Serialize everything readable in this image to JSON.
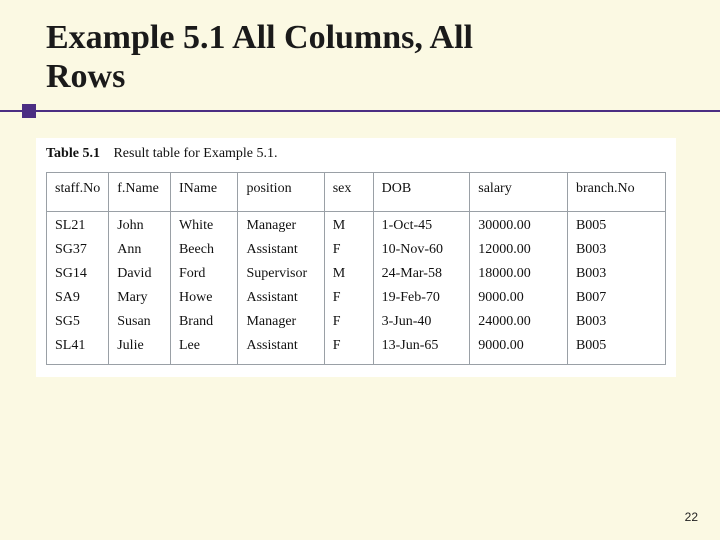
{
  "title_line1": "Example 5.1  All Columns, All",
  "title_line2": "Rows",
  "caption_number": "Table 5.1",
  "caption_text": "Result table for Example 5.1.",
  "columns": [
    "staff.No",
    "f.Name",
    "IName",
    "position",
    "sex",
    "DOB",
    "salary",
    "branch.No"
  ],
  "rows": [
    {
      "staffNo": "SL21",
      "fName": "John",
      "lName": "White",
      "position": "Manager",
      "sex": "M",
      "dob": "1-Oct-45",
      "salary": "30000.00",
      "branchNo": "B005"
    },
    {
      "staffNo": "SG37",
      "fName": "Ann",
      "lName": "Beech",
      "position": "Assistant",
      "sex": "F",
      "dob": "10-Nov-60",
      "salary": "12000.00",
      "branchNo": "B003"
    },
    {
      "staffNo": "SG14",
      "fName": "David",
      "lName": "Ford",
      "position": "Supervisor",
      "sex": "M",
      "dob": "24-Mar-58",
      "salary": "18000.00",
      "branchNo": "B003"
    },
    {
      "staffNo": "SA9",
      "fName": "Mary",
      "lName": "Howe",
      "position": "Assistant",
      "sex": "F",
      "dob": "19-Feb-70",
      "salary": "9000.00",
      "branchNo": "B007"
    },
    {
      "staffNo": "SG5",
      "fName": "Susan",
      "lName": "Brand",
      "position": "Manager",
      "sex": "F",
      "dob": "3-Jun-40",
      "salary": "24000.00",
      "branchNo": "B003"
    },
    {
      "staffNo": "SL41",
      "fName": "Julie",
      "lName": "Lee",
      "position": "Assistant",
      "sex": "F",
      "dob": "13-Jun-65",
      "salary": "9000.00",
      "branchNo": "B005"
    }
  ],
  "page_number": "22"
}
